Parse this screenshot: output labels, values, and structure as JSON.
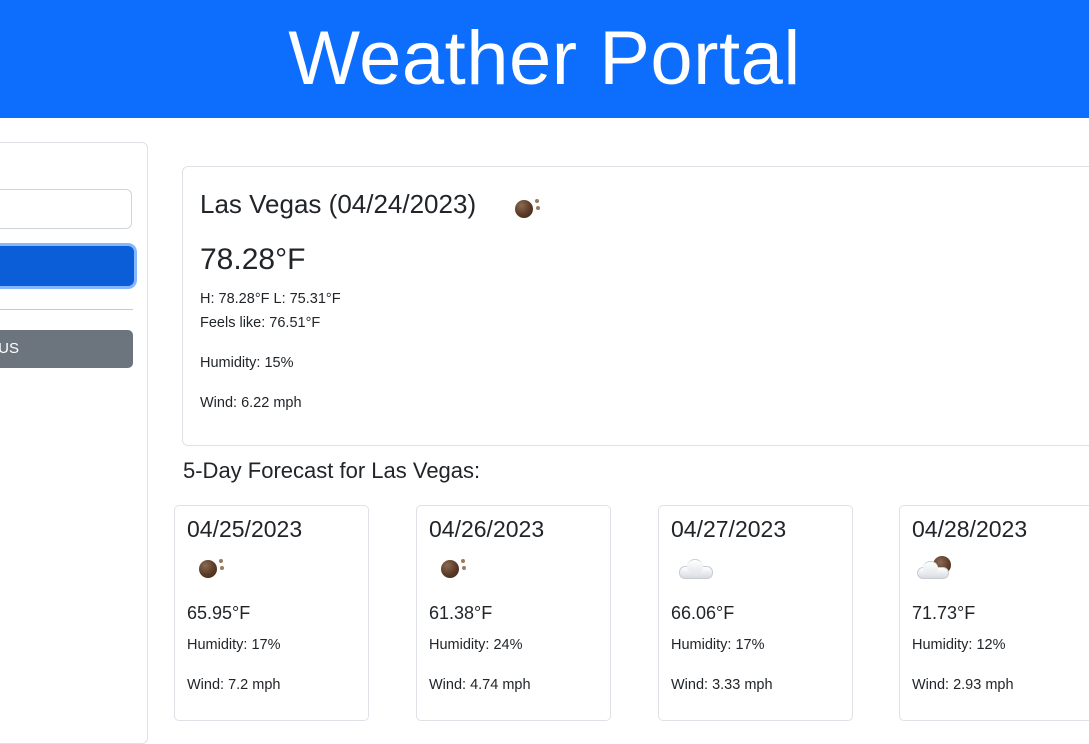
{
  "header": {
    "title": "Weather Portal"
  },
  "sidebar": {
    "search_placeholder": "",
    "search_button_label": "",
    "history": [
      {
        "label": "US"
      }
    ]
  },
  "current": {
    "title": "Las Vegas (04/24/2023)",
    "icon": "rain-icon",
    "temp": "78.28°F",
    "hilo": "H: 78.28°F L: 75.31°F",
    "feels_like": "Feels like: 76.51°F",
    "humidity": "Humidity: 15%",
    "wind": "Wind: 6.22 mph"
  },
  "forecast": {
    "heading": "5-Day Forecast for Las Vegas:",
    "days": [
      {
        "date": "04/25/2023",
        "icon": "rain-icon",
        "temp": "65.95°F",
        "humidity": "Humidity: 17%",
        "wind": "Wind: 7.2 mph"
      },
      {
        "date": "04/26/2023",
        "icon": "rain-icon",
        "temp": "61.38°F",
        "humidity": "Humidity: 24%",
        "wind": "Wind: 4.74 mph"
      },
      {
        "date": "04/27/2023",
        "icon": "cloud-icon",
        "temp": "66.06°F",
        "humidity": "Humidity: 17%",
        "wind": "Wind: 3.33 mph"
      },
      {
        "date": "04/28/2023",
        "icon": "partly-cloudy-icon",
        "temp": "71.73°F",
        "humidity": "Humidity: 12%",
        "wind": "Wind: 2.93 mph"
      }
    ]
  },
  "colors": {
    "header_bg": "#0d6efd",
    "search_button_bg": "#0b5ed7",
    "history_button_bg": "#6c757d"
  }
}
